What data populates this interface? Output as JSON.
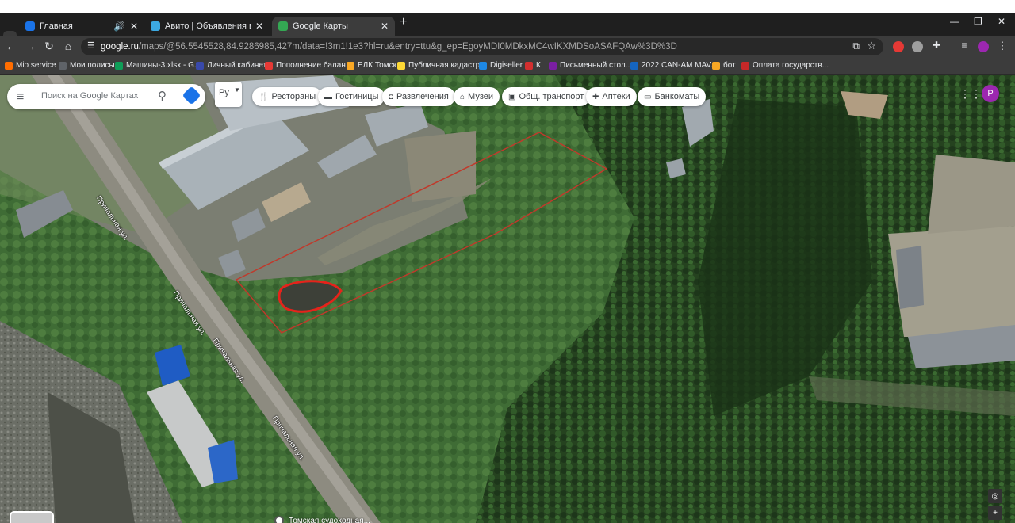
{
  "browser": {
    "tabs": [
      {
        "title": "Главная",
        "icon": "youtube-icon",
        "color": "#1a73e8"
      },
      {
        "title": "Авито | Объявления в Томске",
        "icon": "avito-icon",
        "color": "#3ca9e2"
      },
      {
        "title": "Google Карты",
        "icon": "google-maps-icon",
        "color": "#34a853"
      }
    ],
    "new_tab_label": "+",
    "url_host": "google.ru",
    "url_rest": "/maps/@56.5545528,84.9286985,427m/data=!3m1!1e3?hl=ru&entry=ttu&g_ep=EgoyMDI0MDkxMC4wIKXMDSoASAFQAw%3D%3D",
    "bookmarks": [
      {
        "label": "Mio service",
        "color": "#ff6d00"
      },
      {
        "label": "Мои полисы",
        "color": "#5f6368"
      },
      {
        "label": "Машины-3.xlsx - G...",
        "color": "#0f9d58"
      },
      {
        "label": "Личный кабинет",
        "color": "#3949ab"
      },
      {
        "label": "Пополнение балан...",
        "color": "#e53935"
      },
      {
        "label": "ЕЛК Томск",
        "color": "#f9a825"
      },
      {
        "label": "Публичная кадастр...",
        "color": "#fdd835"
      },
      {
        "label": "Digiseller",
        "color": "#1e88e5"
      },
      {
        "label": "К",
        "color": "#d32f2f"
      },
      {
        "label": "Письменный стол...",
        "color": "#7b1fa2"
      },
      {
        "label": "2022 CAN-AM MAV...",
        "color": "#1565c0"
      },
      {
        "label": "бот",
        "color": "#f9a825"
      },
      {
        "label": "Оплата государств...",
        "color": "#c62828"
      }
    ]
  },
  "maps": {
    "search_placeholder": "Поиск на Google Картах",
    "layer_label": "Ру",
    "chips": [
      {
        "label": "Рестораны",
        "icon": "fork-knife-icon"
      },
      {
        "label": "Гостиницы",
        "icon": "bed-icon"
      },
      {
        "label": "Развлечения",
        "icon": "camera-icon"
      },
      {
        "label": "Музеи",
        "icon": "museum-icon"
      },
      {
        "label": "Общ. транспорт",
        "icon": "bus-icon"
      },
      {
        "label": "Аптеки",
        "icon": "pharmacy-icon"
      },
      {
        "label": "Банкоматы",
        "icon": "atm-icon"
      }
    ],
    "avatar_letter": "P",
    "street_labels": [
      "Причальная ул.",
      "Причальная ул.",
      "Причальная ул.",
      "Причальная ул."
    ],
    "poi_label": "Томская судоходная..."
  }
}
